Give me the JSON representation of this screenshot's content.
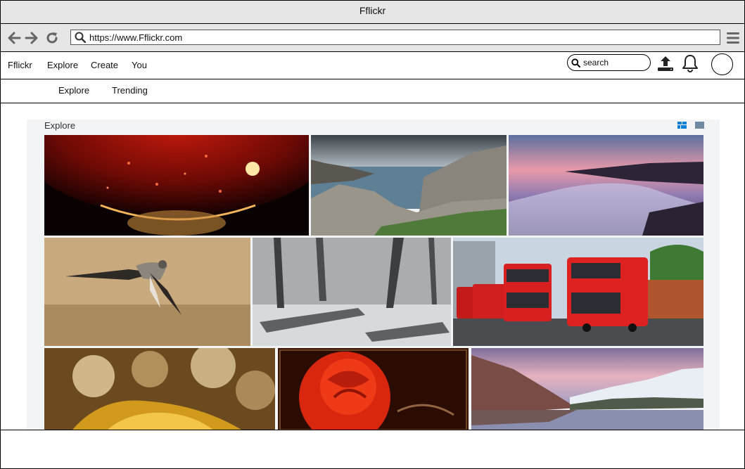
{
  "window": {
    "title": "Fflickr"
  },
  "browser": {
    "url": "https://www.Fflickr.com"
  },
  "header": {
    "logo": "Fflickr",
    "nav": [
      "Explore",
      "Create",
      "You"
    ],
    "search_placeholder": "search"
  },
  "subnav": {
    "tabs": [
      "Explore",
      "Trending"
    ]
  },
  "explore": {
    "heading": "Explore",
    "accent_color": "#0f7fd6",
    "photos": [
      {
        "subject": "red wine glass bokeh"
      },
      {
        "subject": "rocky coastline"
      },
      {
        "subject": "sunset sea waves"
      },
      {
        "subject": "bird in flight"
      },
      {
        "subject": "snowy forest"
      },
      {
        "subject": "red double-decker buses"
      },
      {
        "subject": "golden bokeh"
      },
      {
        "subject": "red rose"
      },
      {
        "subject": "mountain lake sunset"
      }
    ]
  }
}
